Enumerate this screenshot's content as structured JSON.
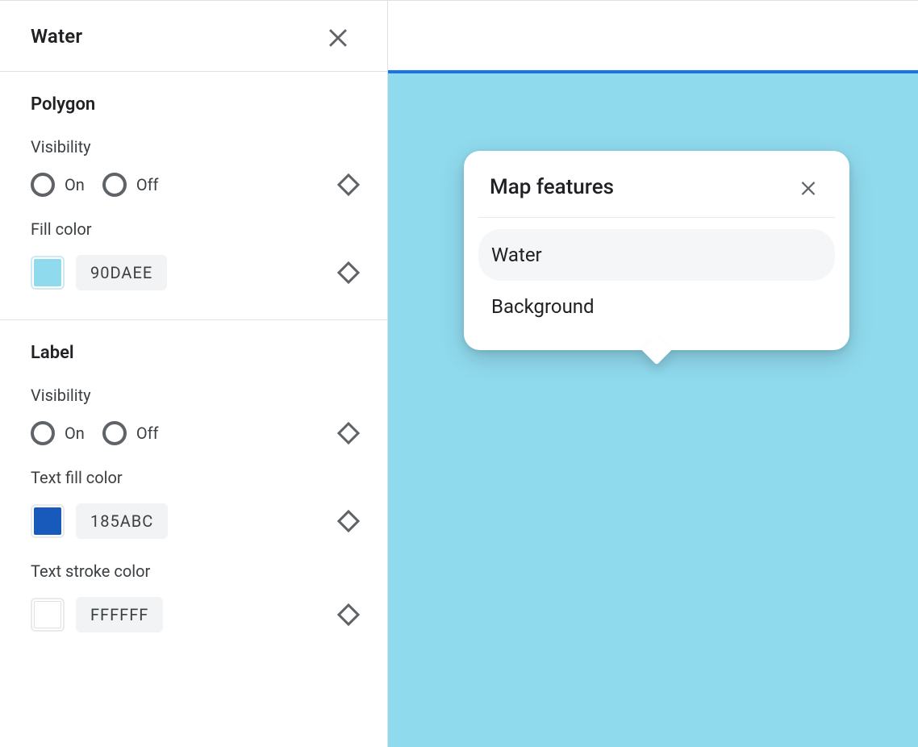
{
  "sidebar": {
    "title": "Water",
    "sections": [
      {
        "heading": "Polygon",
        "visibility": {
          "label": "Visibility",
          "on": "On",
          "off": "Off"
        },
        "fill": {
          "label": "Fill color",
          "hex": "90DAEE",
          "swatch": "#90daee",
          "swatch_border": "#cfe9f3"
        }
      },
      {
        "heading": "Label",
        "visibility": {
          "label": "Visibility",
          "on": "On",
          "off": "Off"
        },
        "textFill": {
          "label": "Text fill color",
          "hex": "185ABC",
          "swatch": "#185abc"
        },
        "textStroke": {
          "label": "Text stroke color",
          "hex": "FFFFFF",
          "swatch": "#ffffff"
        }
      }
    ]
  },
  "map": {
    "accent": "#1a73e8",
    "water_color": "#90daee",
    "popover": {
      "title": "Map features",
      "items": [
        {
          "label": "Water",
          "selected": true
        },
        {
          "label": "Background",
          "selected": false
        }
      ]
    }
  }
}
